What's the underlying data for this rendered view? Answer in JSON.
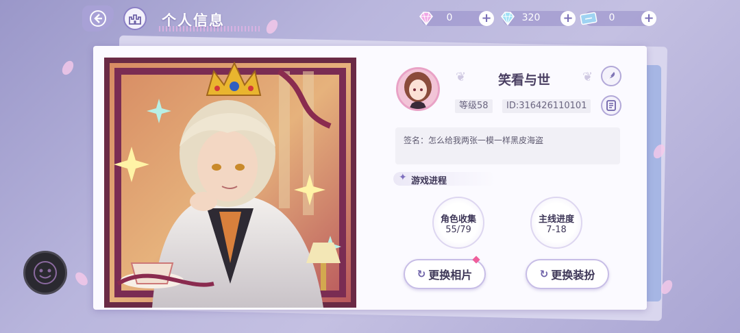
{
  "header": {
    "title": "个人信息"
  },
  "currencies": [
    {
      "icon": "pink-diamond-icon",
      "value": "0"
    },
    {
      "icon": "blue-diamond-icon",
      "value": "320"
    },
    {
      "icon": "ticket-icon",
      "value": "0"
    }
  ],
  "profile": {
    "name": "笑看与世",
    "level": "等级58",
    "id": "ID:316426110101",
    "signature": "签名：怎么给我两张一模一样黑皮海盗"
  },
  "progress": {
    "heading": "游戏进程",
    "stats": [
      {
        "label": "角色收集",
        "value": "55/79"
      },
      {
        "label": "主线进度",
        "value": "7-18"
      }
    ]
  },
  "actions": {
    "change_photo": "更换相片",
    "change_outfit": "更换装扮"
  },
  "colors": {
    "accent": "#8b7fc5",
    "card_bg": "#fbfaff",
    "badge_red": "#ef5f9b"
  }
}
